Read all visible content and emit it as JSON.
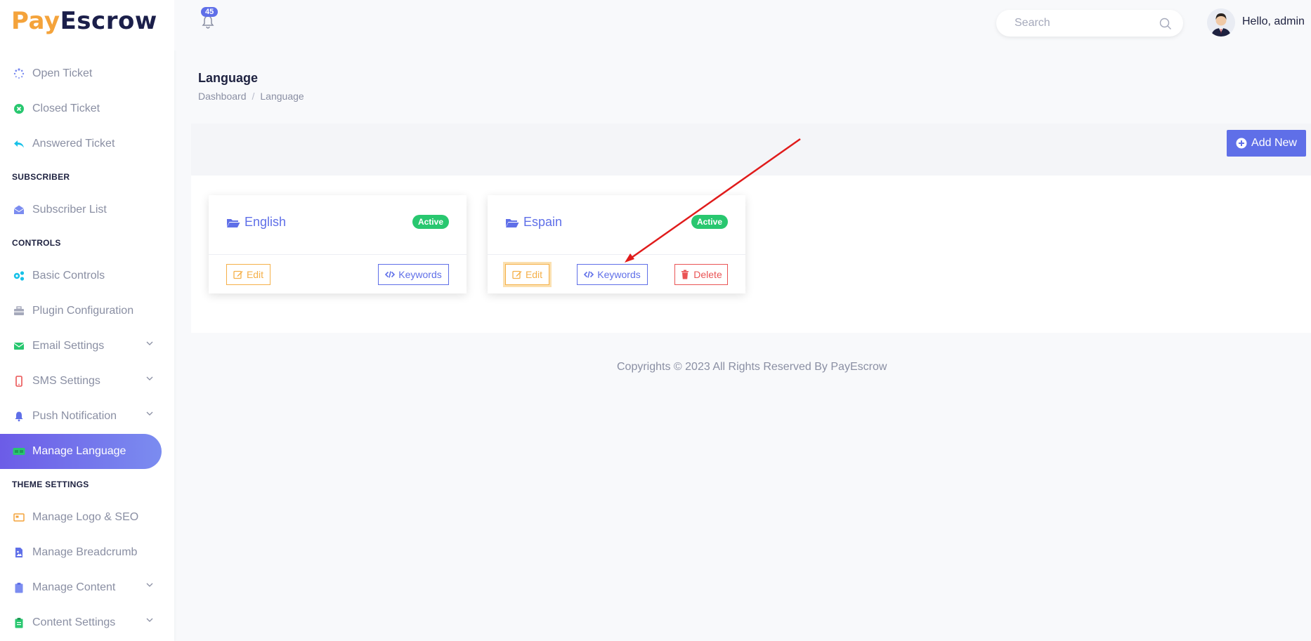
{
  "brand": {
    "part1": "Pay",
    "part2": "Escrow"
  },
  "sidebar": {
    "items": [
      {
        "label": "Open Ticket",
        "icon": "spinner-icon",
        "color": "#7b8cf0"
      },
      {
        "label": "Closed Ticket",
        "icon": "x-circle-icon",
        "color": "#28c76f"
      },
      {
        "label": "Answered Ticket",
        "icon": "reply-icon",
        "color": "#17c1e8"
      }
    ],
    "section_subscriber": "SUBSCRIBER",
    "subscriber_items": [
      {
        "label": "Subscriber List",
        "icon": "envelope-open-icon",
        "color": "#7b8cf0"
      }
    ],
    "section_controls": "CONTROLS",
    "control_items": [
      {
        "label": "Basic Controls",
        "icon": "cogs-icon",
        "color": "#17c1e8"
      },
      {
        "label": "Plugin Configuration",
        "icon": "toolbox-icon",
        "color": "#8a8fa3"
      },
      {
        "label": "Email Settings",
        "icon": "envelope-icon",
        "color": "#28c76f"
      },
      {
        "label": "SMS Settings",
        "icon": "mobile-icon",
        "color": "#ea5455"
      },
      {
        "label": "Push Notification",
        "icon": "bell-icon",
        "color": "#5f6fe8"
      },
      {
        "label": "Manage Language",
        "icon": "language-icon",
        "color": "#28c76f"
      }
    ],
    "section_theme": "THEME SETTINGS",
    "theme_items": [
      {
        "label": "Manage Logo & SEO",
        "icon": "image-icon",
        "color": "#f4a33b"
      },
      {
        "label": "Manage Breadcrumb",
        "icon": "file-image-icon",
        "color": "#5f6fe8"
      },
      {
        "label": "Manage Content",
        "icon": "clipboard-icon",
        "color": "#7b8cf0"
      },
      {
        "label": "Content Settings",
        "icon": "clipboard-list-icon",
        "color": "#28c76f"
      }
    ]
  },
  "topbar": {
    "notification_count": "45",
    "search_placeholder": "Search",
    "greeting": "Hello, admin"
  },
  "page": {
    "title": "Language",
    "breadcrumb": [
      "Dashboard",
      "Language"
    ],
    "add_button": "Add New"
  },
  "languages": [
    {
      "name": "English",
      "status": "Active",
      "edit": "Edit",
      "keywords": "Keywords"
    },
    {
      "name": "Espain",
      "status": "Active",
      "edit": "Edit",
      "keywords": "Keywords",
      "delete": "Delete"
    }
  ],
  "footer": "Copyrights © 2023 All Rights Reserved By PayEscrow",
  "colors": {
    "primary": "#5f6fe8",
    "success": "#28c76f",
    "warning": "#f5b049",
    "danger": "#ea5455",
    "annotation_arrow": "#e01b1b"
  }
}
